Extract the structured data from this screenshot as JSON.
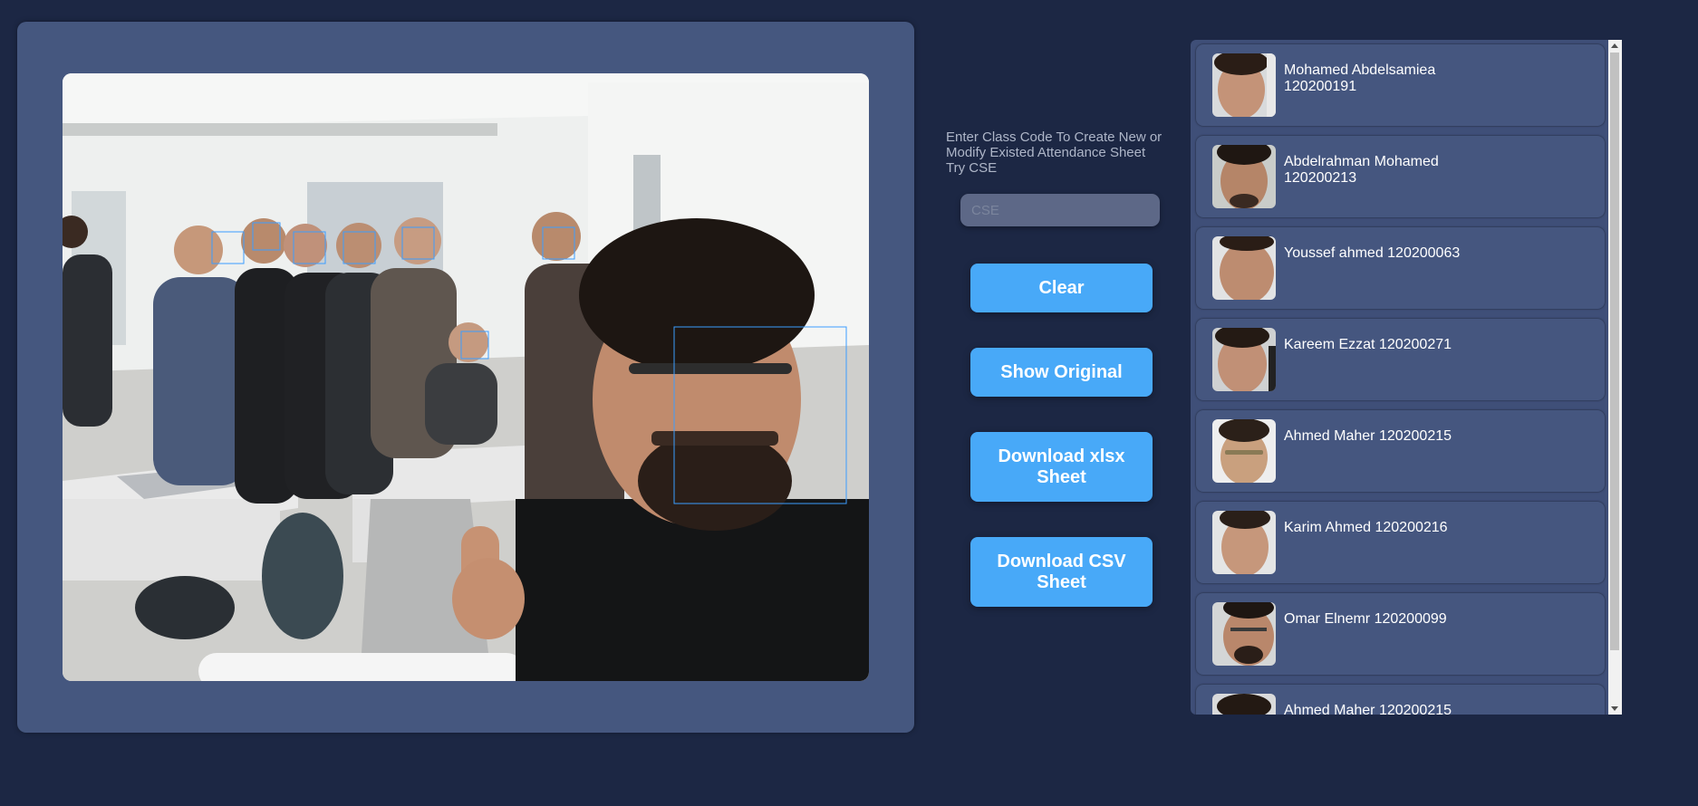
{
  "photo": {
    "alt": "classroom selfie with detected faces",
    "detections": [
      {
        "name": "Mohamed Abdelsamiea 120200191"
      },
      {
        "name": "Abdelrahman Mohamed 120200213"
      },
      {
        "name": "Youssef ahmed 120200063"
      },
      {
        "name": "Kareem Ezzat 120200271"
      },
      {
        "name": "Ahmed Maher 120200215"
      },
      {
        "name": "Karim Ahmed 120200216"
      },
      {
        "name": "Omar Elnemr 120200099"
      }
    ]
  },
  "controls": {
    "prompt": "Enter Class Code To Create New or Modify Existed Attendance Sheet Try CSE",
    "class_code_placeholder": "CSE",
    "clear_label": "Clear",
    "show_original_label": "Show Original",
    "download_xlsx_label": "Download xlsx Sheet",
    "download_csv_label": "Download CSV Sheet"
  },
  "attendance_list": [
    {
      "label": "Mohamed Abdelsamiea 120200191"
    },
    {
      "label": "Abdelrahman Mohamed 120200213"
    },
    {
      "label": "Youssef ahmed 120200063"
    },
    {
      "label": "Kareem Ezzat 120200271"
    },
    {
      "label": "Ahmed Maher 120200215"
    },
    {
      "label": "Karim Ahmed 120200216"
    },
    {
      "label": "Omar Elnemr 120200099"
    },
    {
      "label": "Ahmed Maher 120200215"
    }
  ],
  "colors": {
    "background": "#1c2744",
    "panel": "#45577f",
    "accent_button": "#48a9f8",
    "detection_box": "#3b9dff"
  }
}
